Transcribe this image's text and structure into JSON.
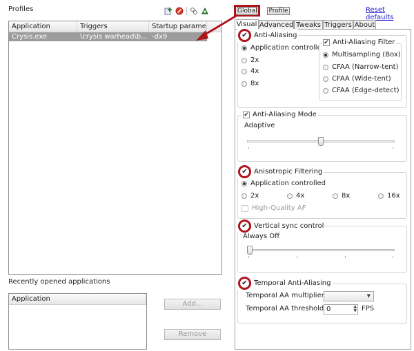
{
  "left": {
    "profiles_label": "Profiles",
    "profiles_table": {
      "columns": [
        "Application",
        "Triggers",
        "Startup parame..."
      ],
      "rows": [
        {
          "application": "Crysis.exe",
          "triggers": "\\crysis warhead\\b...",
          "startup": "-dx9"
        }
      ]
    },
    "recent_label": "Recently opened applications",
    "recent_table": {
      "columns": [
        "Application"
      ]
    },
    "add_button": "Add...",
    "remove_button": "Remove"
  },
  "top": {
    "global_button": "Global",
    "profile_button": "Profile",
    "reset_link": "Reset defaults"
  },
  "tabs": [
    "Visual",
    "Advanced",
    "Tweaks",
    "Triggers",
    "About"
  ],
  "aa": {
    "title": "Anti-Aliasing",
    "options": [
      "Application controlled",
      "2x",
      "4x",
      "8x"
    ],
    "filter_title": "Anti-Aliasing Filter",
    "filter_options": [
      "Multisampling (Box)",
      "CFAA (Narrow-tent)",
      "CFAA (Wide-tent)",
      "CFAA (Edge-detect)"
    ]
  },
  "aa_mode": {
    "title": "Anti-Aliasing Mode",
    "value_text": "Adaptive",
    "level": 0.5
  },
  "af": {
    "title": "Anisotropic Filtering",
    "app_controlled": "Application controlled",
    "options": [
      "2x",
      "4x",
      "8x",
      "16x"
    ],
    "hq_label": "High-Quality AF"
  },
  "vsync": {
    "title": "Vertical sync control",
    "value_text": "Always Off",
    "level": 0.0
  },
  "temporal": {
    "title": "Temporal Anti-Aliasing",
    "multiplier_label": "Temporal AA multiplier",
    "threshold_label": "Temporal AA threshold",
    "threshold_value": "0",
    "fps_label": "FPS"
  },
  "colors": {
    "highlight": "#b0141b",
    "selected_row": "#9c9c9c",
    "link": "#1a1ad0"
  }
}
